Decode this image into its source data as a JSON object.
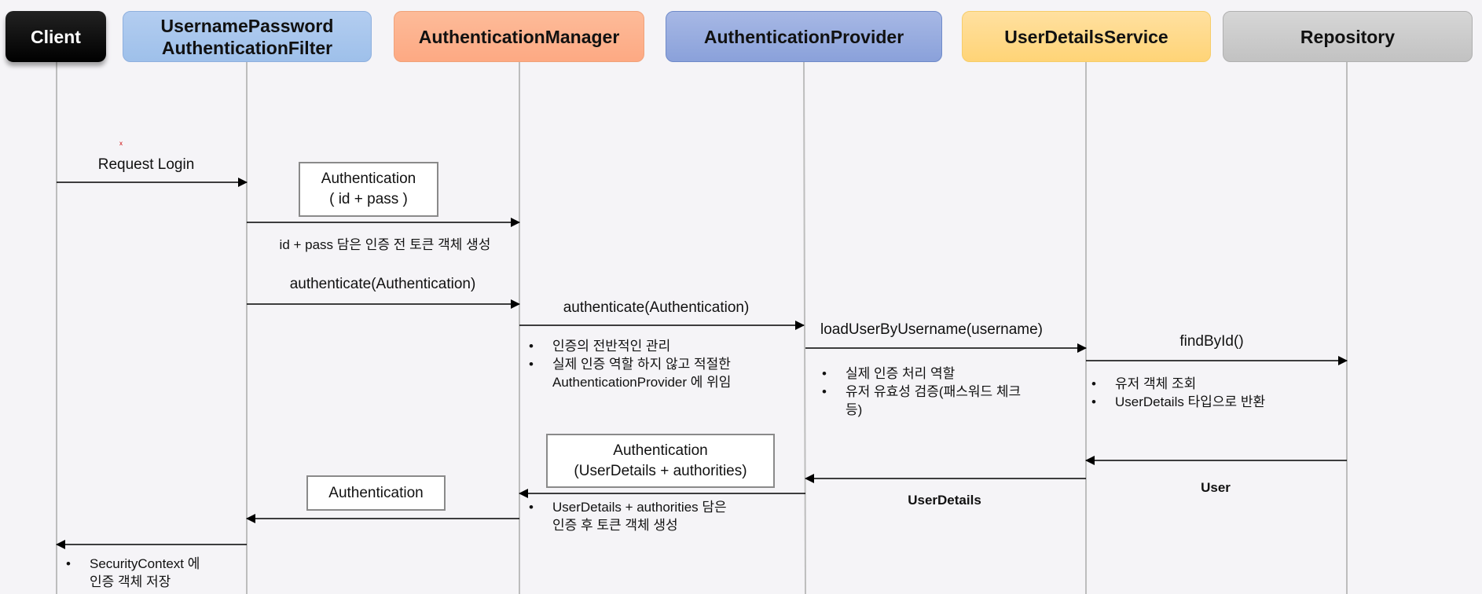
{
  "participants": [
    {
      "id": "client",
      "label": "Client",
      "fill": "#000000"
    },
    {
      "id": "filter",
      "label": "UsernamePassword\nAuthenticationFilter",
      "fill": "#a9c6ec"
    },
    {
      "id": "manager",
      "label": "AuthenticationManager",
      "fill": "#fdb38e"
    },
    {
      "id": "provider",
      "label": "AuthenticationProvider",
      "fill": "#94a9dc"
    },
    {
      "id": "uds",
      "label": "UserDetailsService",
      "fill": "#ffd98a"
    },
    {
      "id": "repo",
      "label": "Repository",
      "fill": "#cccccc"
    }
  ],
  "messages": {
    "request_login": "Request Login",
    "token_box_1": [
      "Authentication",
      "( id + pass )"
    ],
    "token_note_1": "id + pass 담은 인증 전 토큰 객체 생성",
    "authenticate_1": "authenticate(Authentication)",
    "authenticate_2": "authenticate(Authentication)",
    "load_user": "loadUserByUsername(username)",
    "find_by_id": "findById()",
    "return_user": "User",
    "return_user_details": "UserDetails",
    "token_box_2": [
      "Authentication",
      "(UserDetails +  authorities)"
    ],
    "token_box_3": "Authentication"
  },
  "notes": {
    "manager": [
      "인증의 전반적인 관리",
      "실제 인증 역할 하지 않고 적절한",
      "AuthenticationProvider 에 위임"
    ],
    "provider": [
      "실제 인증 처리 역할",
      "유저 유효성 검증(패스워드 체크",
      "등)"
    ],
    "uds": [
      "유저 객체 조회",
      "UserDetails 타입으로 반환"
    ],
    "manager_after": [
      "UserDetails +  authorities 담은",
      "인증 후 토큰 객체 생성"
    ],
    "client": [
      "SecurityContext 에",
      "인증 객체 저장"
    ]
  },
  "bullet": "•"
}
